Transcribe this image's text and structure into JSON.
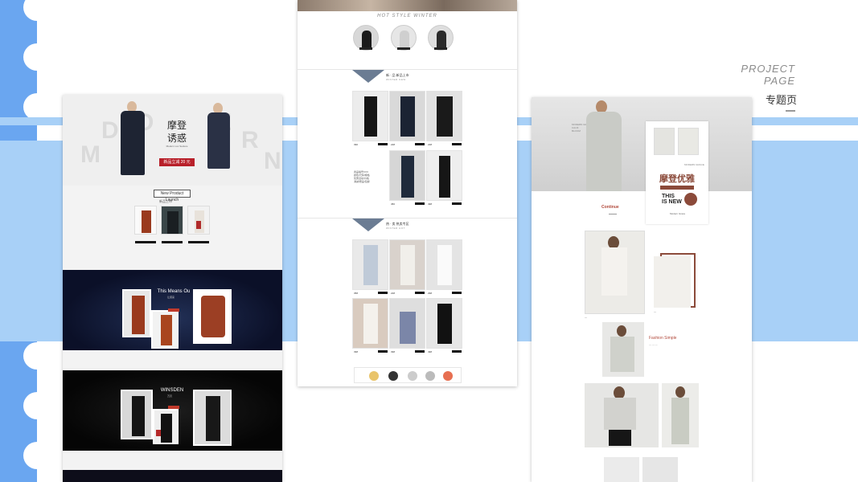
{
  "heading": {
    "project": "PROJECT",
    "page": "PAGE",
    "cn": "专题页"
  },
  "panel1": {
    "hero_letters": [
      "M",
      "D",
      "O",
      "E",
      "R",
      "N"
    ],
    "hero_title_1": "摩登",
    "hero_title_2": "诱惑",
    "hero_sub": "Modern Lux Seduce",
    "promo": "新品立减 20 元",
    "launch": "New Product Launch",
    "launch_sub": "新品上市",
    "sec1_title": "This Means Ou",
    "sec1_sub": "让惑来",
    "sec2_title": "WINSDEN",
    "sec2_sub": "万贝"
  },
  "panel2": {
    "hot_style": "HOT STYLE WINTER",
    "sec1_label": "新 · 品   新品上市",
    "sec1_en": "WINTER NEW",
    "sec2_label": "热 · 卖   热卖专区",
    "sec2_en": "WINTER HOT",
    "row1_prices": [
      "390",
      "228",
      "228"
    ],
    "row2_prices": [
      "450",
      "498"
    ],
    "row3_prices": [
      "358",
      "228",
      "298"
    ],
    "row4_prices": [
      "398",
      "398",
      "498"
    ],
    "note": "商品编号XXX\n颜色/尺码/规格\n优惠活动/价格\n满减/赠品/包邮"
  },
  "panel3": {
    "card_en": "MODERN GRACE",
    "card_title": "摩登优雅",
    "card_this": "THIS",
    "card_is_new": "IS NEW",
    "card_sub": "Modern Grace",
    "hero_left_text": "MODERN GRACE\nCALM\nBLOOM",
    "continue": "Continue",
    "fashion": "Fashion Simple"
  },
  "colors": {
    "accent_blue": "#6aa6f0",
    "band_blue": "#a8d0f7",
    "promo_red": "#b8202a",
    "brand_brown": "#8b4a3a"
  }
}
